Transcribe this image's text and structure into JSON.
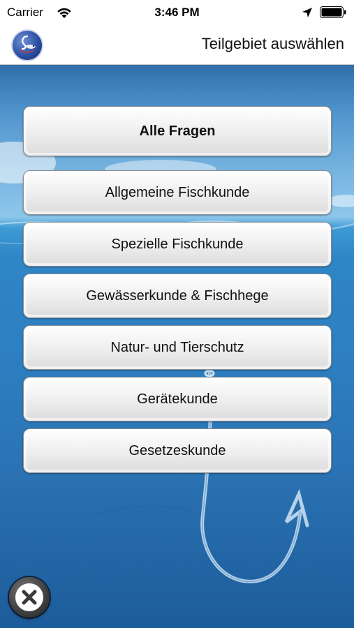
{
  "status_bar": {
    "carrier": "Carrier",
    "time": "3:46 PM",
    "icons": [
      "wifi-icon",
      "location-arrow-icon",
      "battery-icon"
    ]
  },
  "nav_bar": {
    "logo_icon": "app-logo-icon",
    "title": "Teilgebiet auswählen"
  },
  "menu": {
    "all_questions": "Alle Fragen",
    "items": [
      "Allgemeine Fischkunde",
      "Spezielle Fischkunde",
      "Gewässerkunde & Fischhege",
      "Natur- und Tierschutz",
      "Gerätekunde",
      "Gesetzeskunde"
    ]
  },
  "close_button": {
    "icon": "close-icon"
  },
  "colors": {
    "water_top": "#2f6ea8",
    "water_sky": "#8cc6ea",
    "water_deep": "#1d5c9a",
    "button_top": "#ffffff",
    "button_bottom": "#dcdcdc"
  }
}
